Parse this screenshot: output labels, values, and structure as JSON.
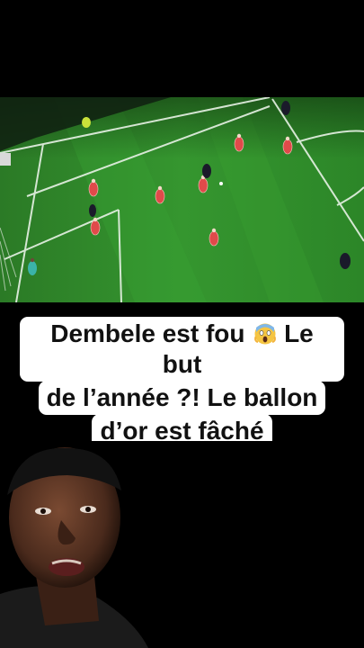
{
  "video": {
    "description_name": "football-match-clip"
  },
  "caption": {
    "line1": "Dembele est fou",
    "emoji_icon": "screaming-face-icon",
    "line1_tail": "Le but",
    "line2": "de l’année ?! Le ballon",
    "line3": "d’or est fâché"
  },
  "colors": {
    "background": "#000000",
    "pitch_green": "#2f8a2a",
    "caption_bg": "#ffffff",
    "caption_text": "#111111",
    "home_kit": "#e04a4a",
    "away_kit": "#1a1a2a"
  }
}
